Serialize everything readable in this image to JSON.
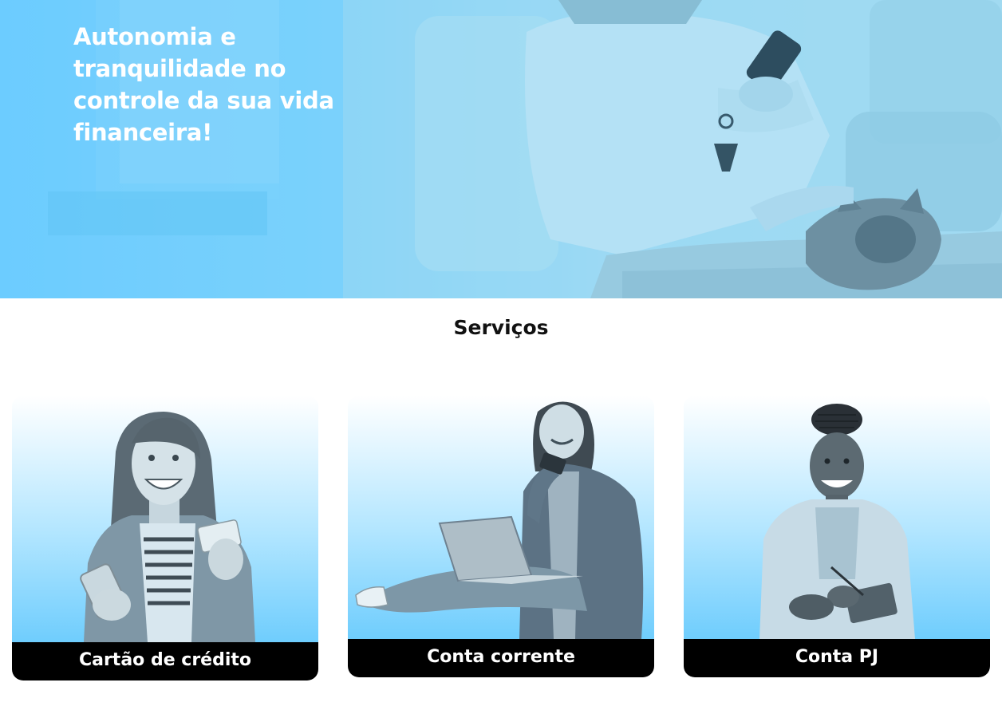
{
  "hero": {
    "title": "Autonomia e tranquilidade no controle da sua vida financeira!"
  },
  "services": {
    "heading": "Serviços",
    "cards": [
      {
        "label": "Cartão de crédito",
        "image": "woman-holding-credit-card-and-phone"
      },
      {
        "label": "Conta corrente",
        "image": "man-sitting-with-laptop-and-card"
      },
      {
        "label": "Conta PJ",
        "image": "woman-in-blazer-writing-on-notepad"
      }
    ]
  },
  "colors": {
    "accent": "#6cccff",
    "label_bg": "#000000",
    "label_text": "#ffffff",
    "heading_text": "#111111"
  }
}
